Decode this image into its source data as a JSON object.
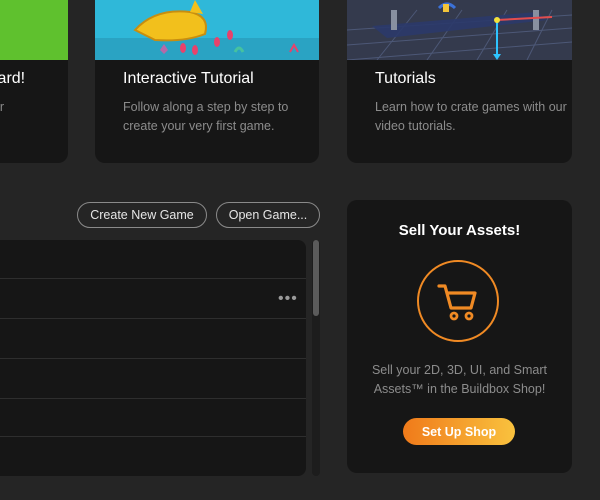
{
  "cards": {
    "wizard": {
      "title": "izard!",
      "desc": "our"
    },
    "interactive": {
      "title": "Interactive Tutorial",
      "desc": "Follow along a step by step to create your very first game."
    },
    "tutorials": {
      "title": "Tutorials",
      "desc": "Learn how to crate games with our video tutorials."
    }
  },
  "toolbar": {
    "create_label": "Create New Game",
    "open_label": "Open Game..."
  },
  "games_list": {
    "more_label": "•••"
  },
  "sell": {
    "title": "Sell Your Assets!",
    "description": "Sell your 2D, 3D, UI, and Smart Assets™ in the Buildbox Shop!",
    "button_label": "Set Up Shop"
  },
  "colors": {
    "accent_orange": "#f08a24",
    "card_bg": "#161616",
    "page_bg": "#252525"
  },
  "icons": {
    "cart": "cart-icon",
    "more": "more-icon"
  }
}
